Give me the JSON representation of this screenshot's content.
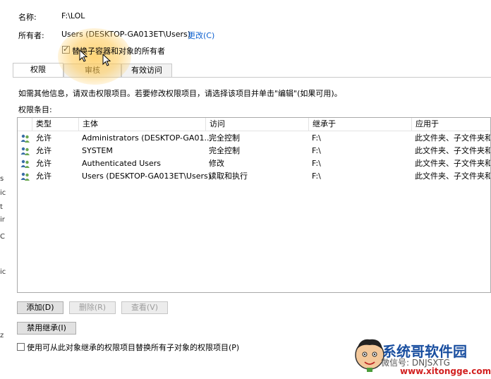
{
  "left_fragments": [
    "s",
    "ic",
    "t",
    "ir",
    "C",
    "ic",
    "z"
  ],
  "header": {
    "name_label": "名称:",
    "name_value": "F:\\LOL",
    "owner_label": "所有者:",
    "owner_value": "Users (DESKTOP-GA013ET\\Users)",
    "owner_change_link": "更改(C)",
    "replace_owner_checkbox": {
      "label": "替换子容器和对象的所有者",
      "checked": true
    }
  },
  "tabs": [
    {
      "label": "权限",
      "active": true
    },
    {
      "label": "审核",
      "active": false
    },
    {
      "label": "有效访问",
      "active": false
    }
  ],
  "instructions": "如需其他信息，请双击权限项目。若要修改权限项目，请选择该项目并单击\"编辑\"(如果可用)。",
  "entries_label": "权限条目:",
  "table": {
    "columns": [
      "类型",
      "主体",
      "访问",
      "继承于",
      "应用于"
    ],
    "rows": [
      {
        "type": "允许",
        "principal": "Administrators (DESKTOP-GA01...",
        "access": "完全控制",
        "inherited_from": "F:\\",
        "applies_to": "此文件夹、子文件夹和文件"
      },
      {
        "type": "允许",
        "principal": "SYSTEM",
        "access": "完全控制",
        "inherited_from": "F:\\",
        "applies_to": "此文件夹、子文件夹和文件"
      },
      {
        "type": "允许",
        "principal": "Authenticated Users",
        "access": "修改",
        "inherited_from": "F:\\",
        "applies_to": "此文件夹、子文件夹和文件"
      },
      {
        "type": "允许",
        "principal": "Users (DESKTOP-GA013ET\\Users)",
        "access": "读取和执行",
        "inherited_from": "F:\\",
        "applies_to": "此文件夹、子文件夹和文件"
      }
    ]
  },
  "buttons": {
    "add": "添加(D)",
    "remove": "删除(R)",
    "view": "查看(V)",
    "disable_inheritance": "禁用继承(I)"
  },
  "replace_child_checkbox": {
    "label": "使用可从此对象继承的权限项目替换所有子对象的权限项目(P)",
    "checked": false
  },
  "watermark": {
    "title": "系统哥软件园",
    "line": "微信号: DNJSXTG",
    "url": "www.xitongge.com"
  },
  "colors": {
    "link": "#0b5fcf",
    "highlight": "#ffc850",
    "watermark_blue": "#1a4fa0",
    "watermark_red": "#d21f1f"
  }
}
